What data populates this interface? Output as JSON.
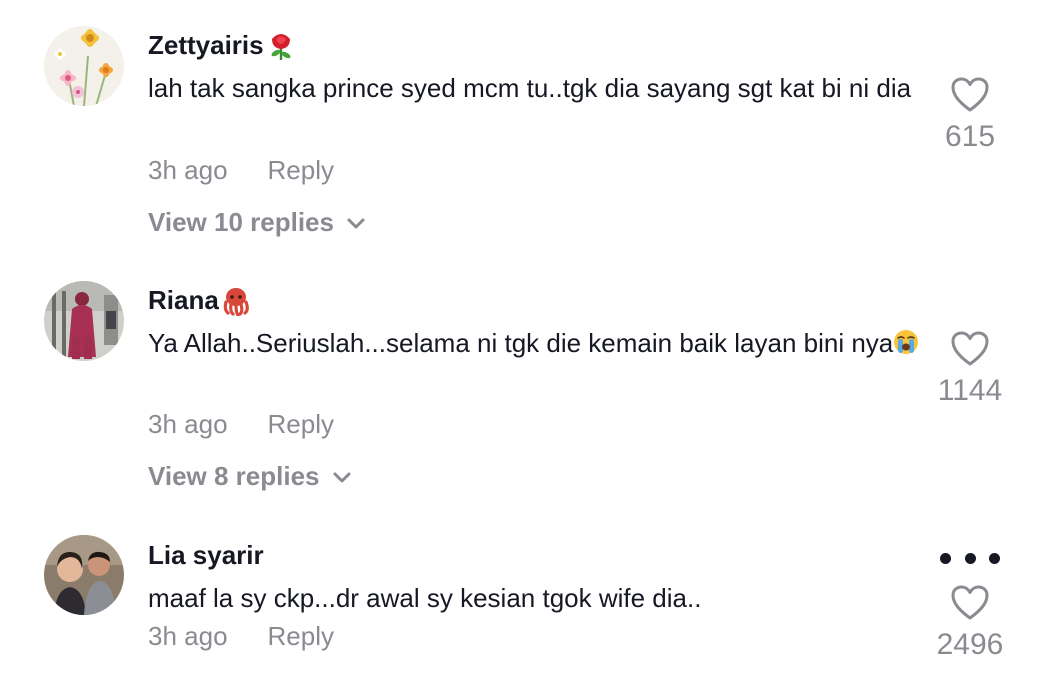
{
  "comments": [
    {
      "username": "Zettyairis",
      "username_emoji": "rose-emoji",
      "text": "lah tak sangka prince syed mcm tu..tgk dia sayang sgt kat bi ni dia",
      "time": "3h ago",
      "reply_label": "Reply",
      "view_replies": "View 10 replies",
      "likes": "615"
    },
    {
      "username": "Riana",
      "username_emoji": "octopus-emoji",
      "text": "Ya Allah..Seriuslah...selama ni tgk die kemain baik layan bini nya",
      "text_emoji": "loudly-crying-face-emoji",
      "time": "3h ago",
      "reply_label": "Reply",
      "view_replies": "View 8 replies",
      "likes": "1144"
    },
    {
      "username": "Lia syarir",
      "text": "maaf la sy ckp...dr awal sy kesian tgok wife dia..",
      "time": "3h ago",
      "reply_label": "Reply",
      "likes": "2496",
      "more_icon": "more-horizontal-icon"
    }
  ],
  "colors": {
    "primary_text": "#161823",
    "secondary_text": "#8a8b91"
  }
}
